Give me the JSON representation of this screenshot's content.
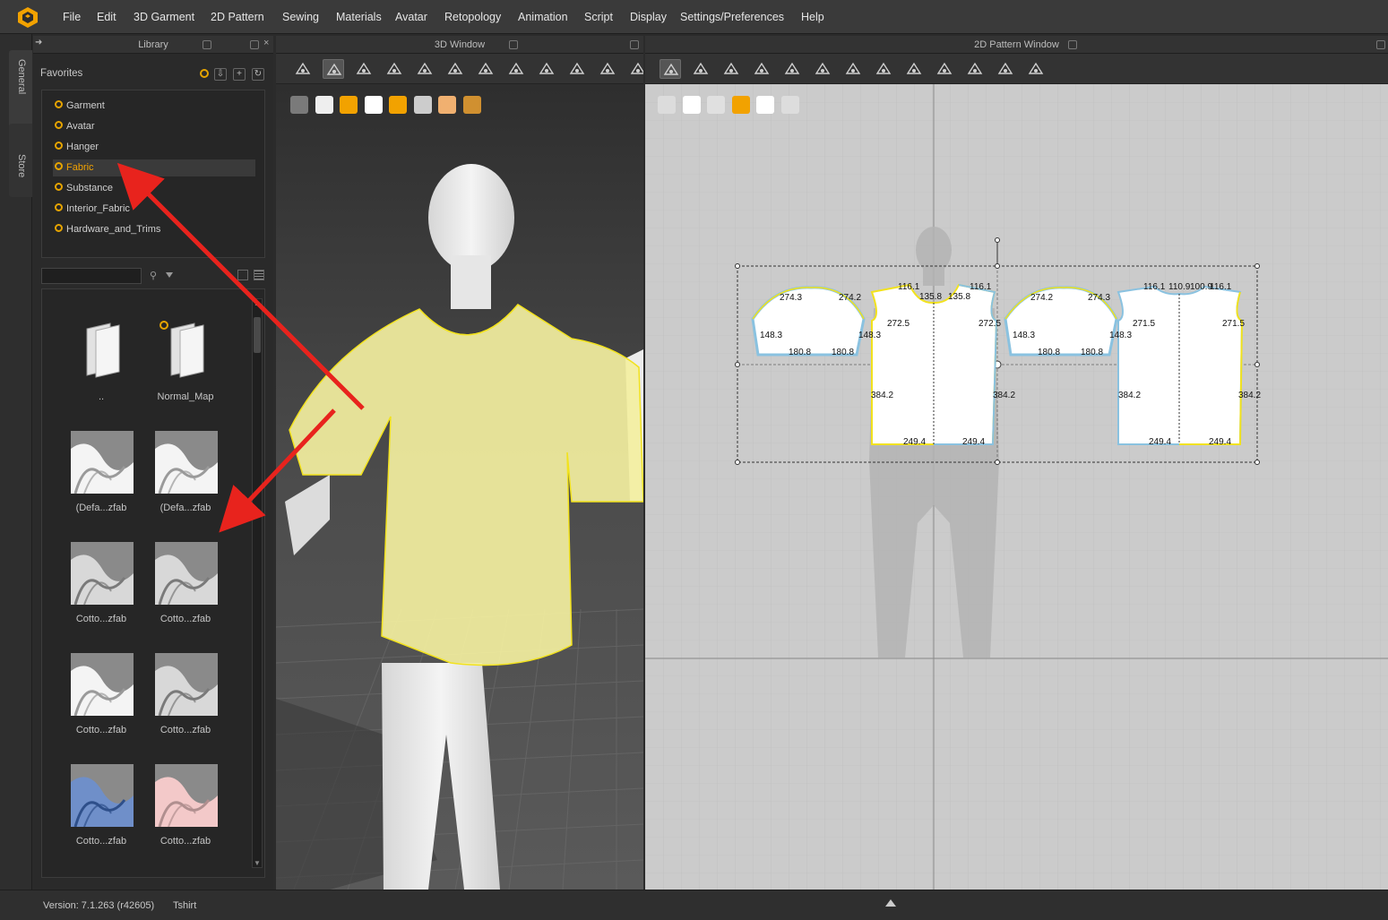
{
  "menu": [
    "File",
    "Edit",
    "3D Garment",
    "2D Pattern",
    "Sewing",
    "Materials",
    "Avatar",
    "Retopology",
    "Animation",
    "Script",
    "Display",
    "Settings/Preferences",
    "Help"
  ],
  "side_tabs": [
    "General",
    "Store"
  ],
  "panels": {
    "library": "Library",
    "window_3d": "3D Window",
    "window_2d": "2D Pattern Window"
  },
  "library": {
    "favorites_label": "Favorites",
    "favorites": [
      {
        "label": "Garment",
        "selected": false
      },
      {
        "label": "Avatar",
        "selected": false
      },
      {
        "label": "Hanger",
        "selected": false
      },
      {
        "label": "Fabric",
        "selected": true
      },
      {
        "label": "Substance",
        "selected": false
      },
      {
        "label": "Interior_Fabric",
        "selected": false
      },
      {
        "label": "Hardware_and_Trims",
        "selected": false
      }
    ],
    "search_value": "",
    "items": [
      {
        "caption": "..",
        "kind": "folder"
      },
      {
        "caption": "Normal_Map",
        "kind": "folder-fav"
      },
      {
        "caption": "(Defa...zfab",
        "kind": "fabric-white"
      },
      {
        "caption": "(Defa...zfab",
        "kind": "fabric-white"
      },
      {
        "caption": "Cotto...zfab",
        "kind": "fabric-grey"
      },
      {
        "caption": "Cotto...zfab",
        "kind": "fabric-grey"
      },
      {
        "caption": "Cotto...zfab",
        "kind": "fabric-white"
      },
      {
        "caption": "Cotto...zfab",
        "kind": "fabric-grey"
      },
      {
        "caption": "Cotto...zfab",
        "kind": "fabric-blue"
      },
      {
        "caption": "Cotto...zfab",
        "kind": "fabric-pink"
      }
    ]
  },
  "pattern_measurements": {
    "sleeve_left": [
      "274.3",
      "274.2",
      "148.3",
      "148.3",
      "180.8",
      "180.8"
    ],
    "front": [
      "116.1",
      "135.8",
      "135.8",
      "116.1",
      "272.5",
      "272.5",
      "384.2",
      "384.2",
      "249.4",
      "249.4"
    ],
    "sleeve_right": [
      "274.2",
      "274.3",
      "148.3",
      "148.3",
      "180.8",
      "180.8"
    ],
    "back": [
      "116.1",
      "110.9",
      "100.9",
      "116.1",
      "271.5",
      "271.5",
      "384.2",
      "384.2",
      "249.4",
      "249.4"
    ]
  },
  "status": {
    "version": "Version:     7.1.263 (r42605)",
    "garment": "Tshirt"
  },
  "colors": {
    "accent": "#f2a200",
    "garment": "#f3efa0",
    "annotation_arrow": "#e8231d",
    "pattern_outline_yellow": "#f2e21d",
    "pattern_outline_blue": "#8ac2e0"
  }
}
